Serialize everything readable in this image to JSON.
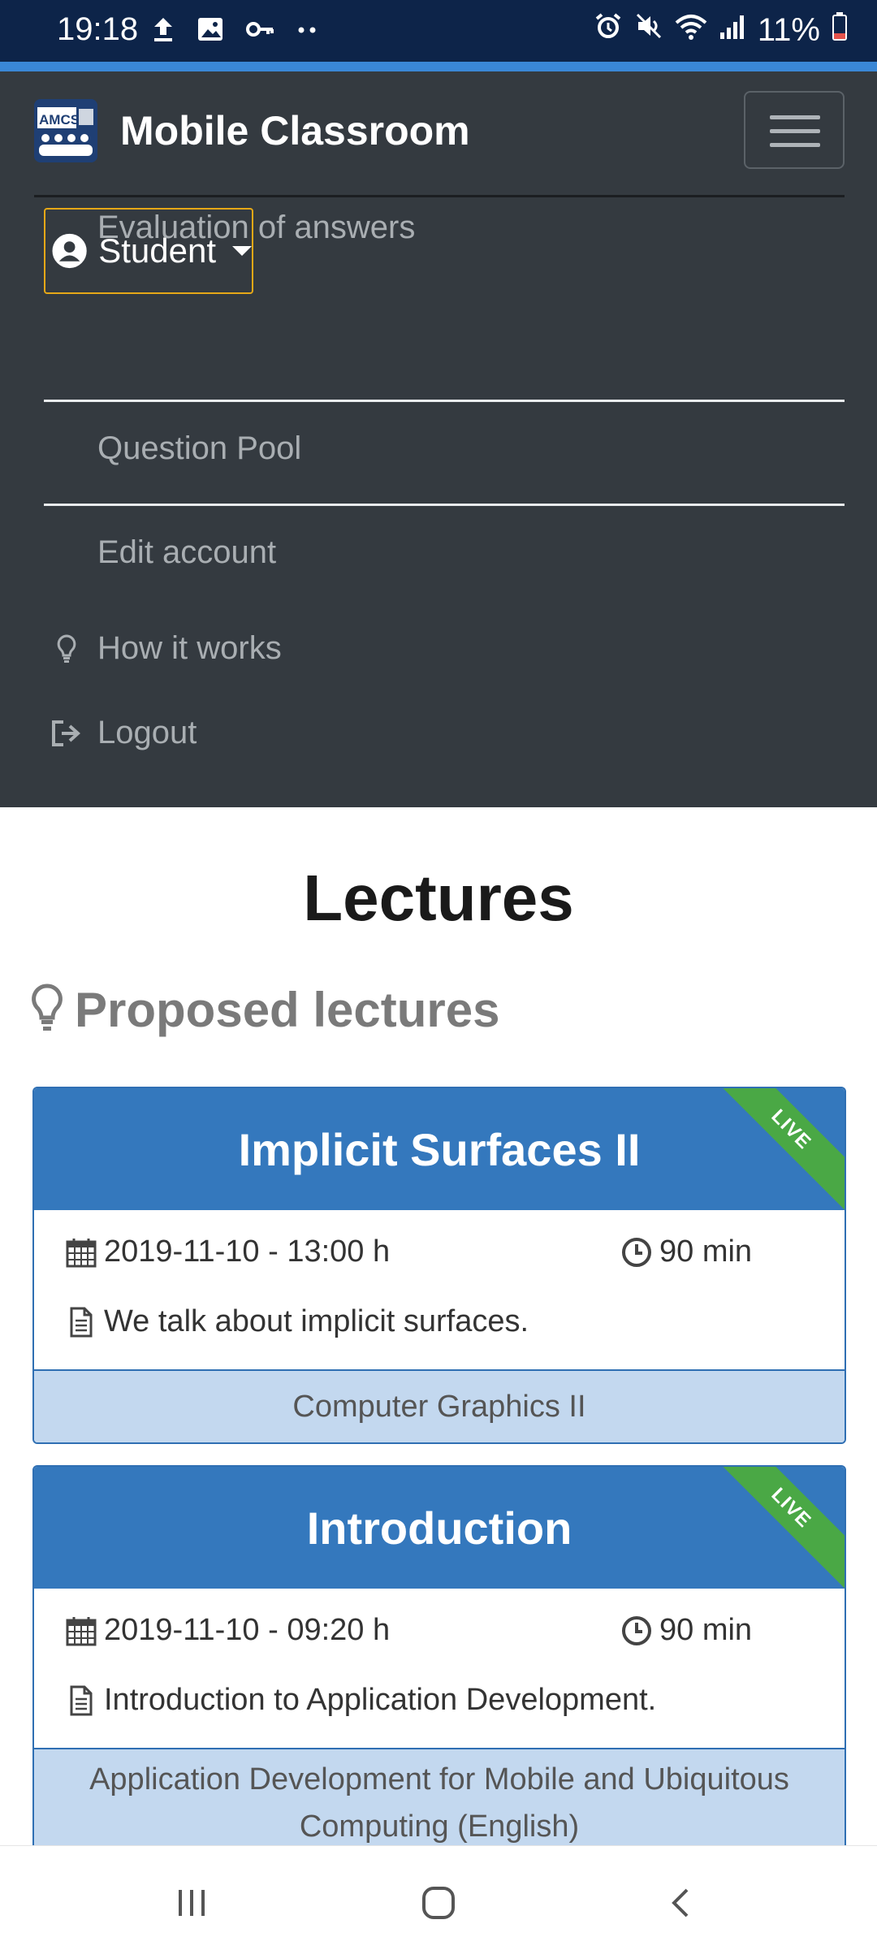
{
  "status_bar": {
    "time": "19:18",
    "battery": "11%",
    "left_icons": [
      "upload-icon",
      "image-icon",
      "key-icon",
      "more-dots-icon"
    ],
    "right_icons": [
      "alarm-icon",
      "mute-icon",
      "wifi-icon",
      "signal-icon",
      "battery-icon"
    ]
  },
  "navbar": {
    "brand_logo_text": "AMCS",
    "brand_name": "Mobile Classroom",
    "dropdown": {
      "label": "Student",
      "items": [
        {
          "label": "Evaluation of answers"
        },
        {
          "label": "Question Pool"
        },
        {
          "label": "Edit account"
        }
      ]
    },
    "links": [
      {
        "label": "How it works",
        "icon": "lightbulb-icon"
      },
      {
        "label": "Logout",
        "icon": "logout-icon"
      }
    ]
  },
  "main": {
    "title": "Lectures",
    "section_title": "Proposed lectures",
    "lectures": [
      {
        "title": "Implicit Surfaces II",
        "badge": "LIVE",
        "datetime": "2019-11-10 - 13:00 h",
        "duration": "90 min",
        "description": "We talk about implicit surfaces.",
        "course": "Computer Graphics II"
      },
      {
        "title": "Introduction",
        "badge": "LIVE",
        "datetime": "2019-11-10 - 09:20 h",
        "duration": "90 min",
        "description": "Introduction to Application Development.",
        "course": "Application Development for Mobile and Ubiquitous Computing (English)"
      }
    ]
  },
  "system_nav": [
    "recents-button",
    "home-button",
    "back-button"
  ],
  "colors": {
    "navbar_bg": "#343a40",
    "card_header": "#3478bd",
    "card_footer": "#c3d8ef",
    "live_badge": "#4aa845",
    "dropdown_border": "#e6a817"
  }
}
